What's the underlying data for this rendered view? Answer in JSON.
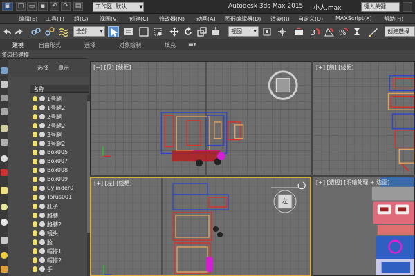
{
  "titlebar": {
    "workspace_label": "工作区: 默认",
    "app_title": "Autodesk 3ds Max  2015",
    "file_title": "小人.max",
    "search_placeholder": "键入关键"
  },
  "menubar": {
    "items": [
      "编辑(E)",
      "工具(T)",
      "组(G)",
      "视图(V)",
      "创建(C)",
      "修改器(M)",
      "动画(A)",
      "图形编辑器(D)",
      "渲染(R)",
      "自定义(U)",
      "MAXScript(X)",
      "帮助(H)"
    ]
  },
  "toolbar": {
    "selection_filter": "全部",
    "reference_coord": "视图",
    "named_selection": "创建选择集"
  },
  "ribbon": {
    "tabs": [
      "建模",
      "自由形式",
      "选择",
      "对象绘制",
      "填充"
    ],
    "sub_label": "多边形建模"
  },
  "explorer": {
    "tab_select": "选择",
    "tab_display": "显示",
    "header": "名称",
    "objects": [
      "1号腿",
      "1号腿2",
      "2号腿",
      "2号腿2",
      "3号腿",
      "3号腿2",
      "Box005",
      "Box007",
      "Box008",
      "Box009",
      "Cylinder0",
      "Torus001",
      "肚子",
      "胳膊",
      "胳膊2",
      "镜头",
      "脸",
      "帽搭1",
      "帽搭2",
      "手"
    ]
  },
  "viewports": {
    "top_label": "[+] [顶] [线框]",
    "front_label": "[+] [前] [线框]",
    "left_label": "[+] [左] [线框]",
    "persp_label": "[+] [透视] [明暗处理 + 边面]",
    "viewcube_left": "左"
  },
  "colors": {
    "grid_bg": "#6e6e6e",
    "active_border": "#d6b03a",
    "wire_red": "#d9302a",
    "wire_blue": "#2f46c8",
    "wire_orange": "#e0a060",
    "wire_magenta": "#d020d0"
  }
}
